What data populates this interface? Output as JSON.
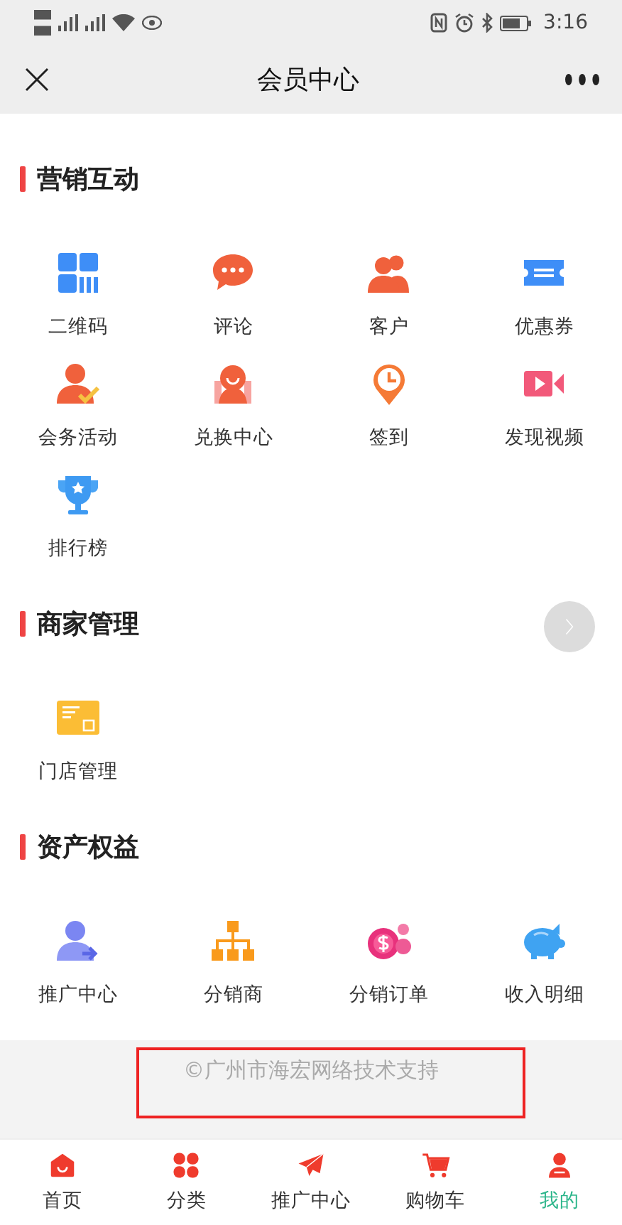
{
  "status_bar": {
    "time": "3:16"
  },
  "nav_bar": {
    "title": "会员中心"
  },
  "sections": [
    {
      "title": "营销互动",
      "items": [
        {
          "label": "二维码"
        },
        {
          "label": "评论"
        },
        {
          "label": "客户"
        },
        {
          "label": "优惠券"
        },
        {
          "label": "会务活动"
        },
        {
          "label": "兑换中心"
        },
        {
          "label": "签到"
        },
        {
          "label": "发现视频"
        },
        {
          "label": "排行榜"
        }
      ]
    },
    {
      "title": "商家管理",
      "items": [
        {
          "label": "门店管理"
        }
      ]
    },
    {
      "title": "资产权益",
      "items": [
        {
          "label": "推广中心"
        },
        {
          "label": "分销商"
        },
        {
          "label": "分销订单"
        },
        {
          "label": "收入明细"
        }
      ]
    }
  ],
  "footer": {
    "text": "©广州市海宏网络技术支持"
  },
  "tab_bar": [
    {
      "label": "首页",
      "selected": false
    },
    {
      "label": "分类",
      "selected": false
    },
    {
      "label": "推广中心",
      "selected": false
    },
    {
      "label": "购物车",
      "selected": false
    },
    {
      "label": "我的",
      "selected": true
    }
  ]
}
